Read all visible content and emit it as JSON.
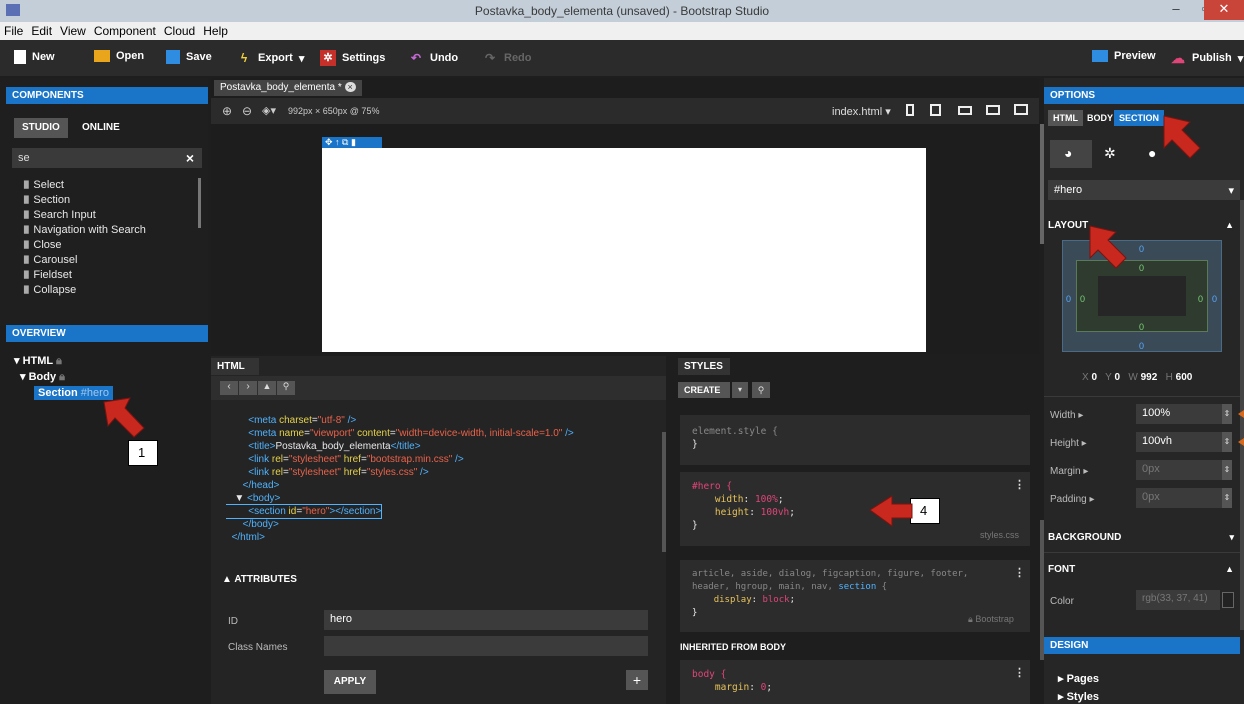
{
  "window": {
    "title": "Postavka_body_elementa (unsaved) - Bootstrap Studio",
    "minimize": "–",
    "maximize": "▫",
    "close": "✕"
  },
  "menu": [
    "File",
    "Edit",
    "View",
    "Component",
    "Cloud",
    "Help"
  ],
  "toolbar": {
    "new": "New",
    "open": "Open",
    "save": "Save",
    "export": "Export",
    "settings": "Settings",
    "undo": "Undo",
    "redo": "Redo",
    "preview": "Preview",
    "publish": "Publish"
  },
  "components": {
    "header": "COMPONENTS",
    "tabs": [
      "STUDIO",
      "ONLINE"
    ],
    "search_value": "se",
    "clear": "×",
    "items": [
      "Select",
      "Section",
      "Search Input",
      "Navigation with Search",
      "Close",
      "Carousel",
      "Fieldset",
      "Collapse"
    ]
  },
  "overview": {
    "header": "OVERVIEW",
    "html": "HTML",
    "body": "Body",
    "section": "Section",
    "section_id": "#hero",
    "callout": "1"
  },
  "canvas": {
    "tab": "Postavka_body_elementa *",
    "size": "992px × 650px @ 75%",
    "page": "index.html"
  },
  "html_panel": {
    "header": "HTML",
    "lines": [
      {
        "indent": "        ",
        "parts": [
          [
            "tag",
            "<meta "
          ],
          [
            "attr",
            "charset"
          ],
          [
            "txt",
            "="
          ],
          [
            "val",
            "\"utf-8\""
          ],
          [
            "tag",
            " />"
          ]
        ]
      },
      {
        "indent": "        ",
        "parts": [
          [
            "tag",
            "<meta "
          ],
          [
            "attr",
            "name"
          ],
          [
            "txt",
            "="
          ],
          [
            "val",
            "\"viewport\""
          ],
          [
            "attr",
            " content"
          ],
          [
            "txt",
            "="
          ],
          [
            "val",
            "\"width=device-width, initial-scale=1.0\""
          ],
          [
            "tag",
            " />"
          ]
        ]
      },
      {
        "indent": "        ",
        "parts": [
          [
            "tag",
            "<title>"
          ],
          [
            "txt",
            "Postavka_body_elementa"
          ],
          [
            "tag",
            "</title>"
          ]
        ]
      },
      {
        "indent": "        ",
        "parts": [
          [
            "tag",
            "<link "
          ],
          [
            "attr",
            "rel"
          ],
          [
            "txt",
            "="
          ],
          [
            "val",
            "\"stylesheet\""
          ],
          [
            "attr",
            " href"
          ],
          [
            "txt",
            "="
          ],
          [
            "val",
            "\"bootstrap.min.css\""
          ],
          [
            "tag",
            " />"
          ]
        ]
      },
      {
        "indent": "        ",
        "parts": [
          [
            "tag",
            "<link "
          ],
          [
            "attr",
            "rel"
          ],
          [
            "txt",
            "="
          ],
          [
            "val",
            "\"stylesheet\""
          ],
          [
            "attr",
            " href"
          ],
          [
            "txt",
            "="
          ],
          [
            "val",
            "\"styles.css\""
          ],
          [
            "tag",
            " />"
          ]
        ]
      },
      {
        "indent": "      ",
        "parts": [
          [
            "tag",
            "</head>"
          ]
        ]
      },
      {
        "indent": "   ▼ ",
        "parts": [
          [
            "tag",
            "<body>"
          ]
        ]
      },
      {
        "indent": "        ",
        "parts": [
          [
            "tag",
            "<section "
          ],
          [
            "attr",
            "id"
          ],
          [
            "txt",
            "="
          ],
          [
            "val",
            "\"hero\""
          ],
          [
            "tag",
            "></section>"
          ]
        ]
      },
      {
        "indent": "      ",
        "parts": [
          [
            "tag",
            "</body>"
          ]
        ]
      },
      {
        "indent": "  ",
        "parts": [
          [
            "tag",
            "</html>"
          ]
        ]
      }
    ],
    "attributes_header": "ATTRIBUTES",
    "id_label": "ID",
    "id_value": "hero",
    "class_label": "Class Names",
    "apply": "APPLY",
    "plus": "+"
  },
  "styles_panel": {
    "header": "STYLES",
    "create": "CREATE",
    "element_style": "element.style {",
    "close_brace": "}",
    "hero_selector": "#hero {",
    "hero_width_prop": "width",
    "hero_width_val": "100%",
    "hero_height_prop": "height",
    "hero_height_val": "100vh",
    "hero_source": "styles.css",
    "article_selector": "article, aside, dialog, figcaption, figure, footer,",
    "article_selector2": "header, hgroup, main, nav, ",
    "article_selector2b": "section",
    "display_prop": "display",
    "display_val": "block",
    "article_source": "Bootstrap",
    "inherited": "INHERITED FROM BODY",
    "body_selector": "body {",
    "body_margin_prop": "margin",
    "body_margin_val": "0",
    "callout": "4"
  },
  "options": {
    "header": "OPTIONS",
    "tabs": [
      "HTML",
      "BODY",
      "SECTION"
    ],
    "selector": "#hero",
    "layout": "LAYOUT",
    "box": {
      "margin_top": "0",
      "padding_top": "0",
      "padding_left": "0",
      "padding_right": "0",
      "margin_left": "0",
      "margin_right": "0",
      "padding_bottom": "0",
      "margin_bottom": "0"
    },
    "coords": {
      "x_label": "X",
      "x": "0",
      "y_label": "Y",
      "y": "0",
      "w_label": "W",
      "w": "992",
      "h_label": "H",
      "h": "600"
    },
    "width_label": "Width",
    "width_value": "100%",
    "height_label": "Height",
    "height_value": "100vh",
    "margin_label": "Margin",
    "margin_value": "0px",
    "padding_label": "Padding",
    "padding_value": "0px",
    "background": "BACKGROUND",
    "font": "FONT",
    "color_label": "Color",
    "color_value": "rgb(33, 37, 41)"
  },
  "design": {
    "header": "DESIGN",
    "items": [
      "Pages",
      "Styles"
    ]
  },
  "colors": {
    "accent": "#1a74c7",
    "callout_arrow": "#c8281e"
  }
}
